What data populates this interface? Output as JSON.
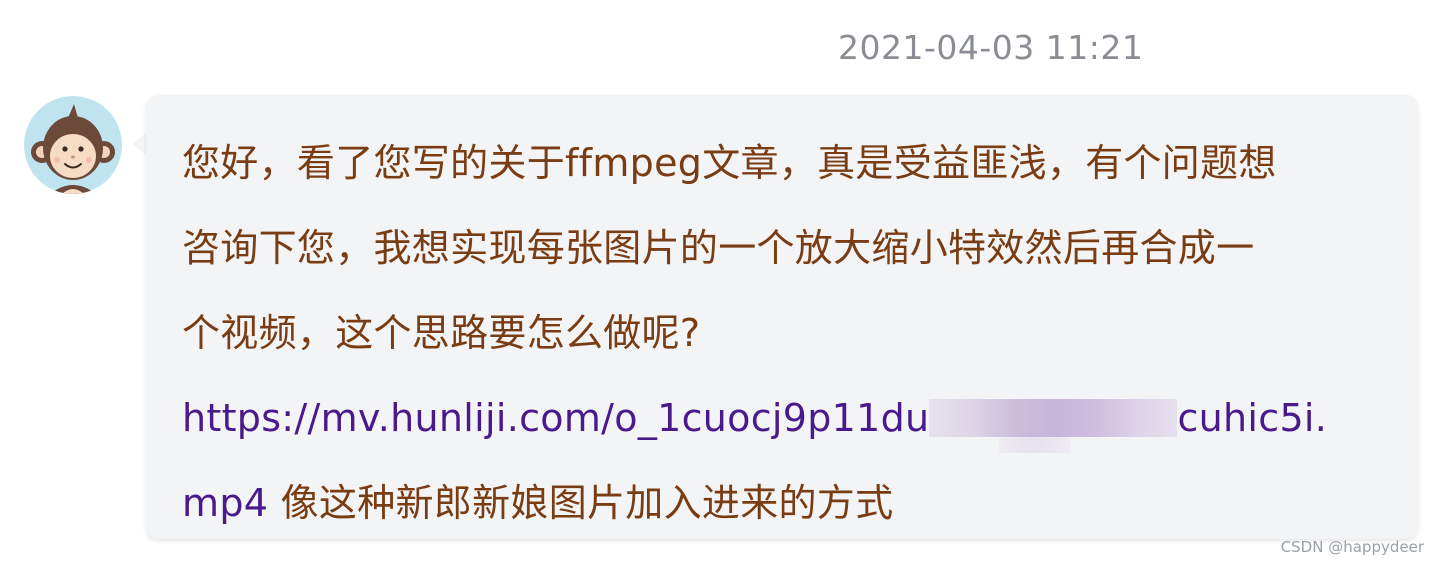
{
  "comment": {
    "timestamp": "2021-04-03 11:21",
    "avatar_icon": "monkey-avatar-icon",
    "lines": [
      "您好，看了您写的关于ffmpeg文章，真是受益匪浅，有个问题想",
      "咨询下您，我想实现每张图片的一个放大缩小特效然后再合成一",
      "个视频，这个思路要怎么做呢?"
    ],
    "link_part1": "https://mv.hunliji.com/o_1cuocj9p11du",
    "link_part2": "cuhic5i.",
    "link_part3": "mp4",
    "trailing_text": " 像这种新郎新娘图片加入进来的方式"
  },
  "watermark": "CSDN @happydeer",
  "colors": {
    "message_text": "#7a3c12",
    "link_text": "#4a1a8c",
    "timestamp_text": "#8a8d93",
    "bubble_bg": "#f3f4f6",
    "avatar_bg": "#bfe4f0"
  }
}
